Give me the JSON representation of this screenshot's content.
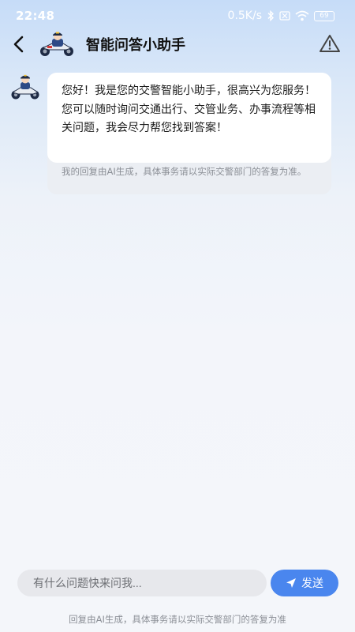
{
  "status_bar": {
    "time": "22:48",
    "network_speed": "0.5K/s",
    "battery": "69"
  },
  "header": {
    "title": "智能问答小助手",
    "back_icon": "chevron-left-icon",
    "warning_icon": "warning-triangle-icon"
  },
  "messages": [
    {
      "sender": "bot",
      "text": "您好！我是您的交警智能小助手，很高兴为您服务！您可以随时询问交通出行、交管业务、办事流程等相关问题，我会尽力帮您找到答案！",
      "disclaimer": "我的回复由AI生成，具体事务请以实际交警部门的答复为准。"
    }
  ],
  "input": {
    "placeholder": "有什么问题快来问我...",
    "value": "",
    "send_label": "发送"
  },
  "footer": {
    "disclaimer": "回复由AI生成，具体事务请以实际交警部门的答复为准"
  },
  "colors": {
    "accent": "#4a86ee",
    "bubble": "#ffffff",
    "input_bg": "#e7e8ec"
  }
}
